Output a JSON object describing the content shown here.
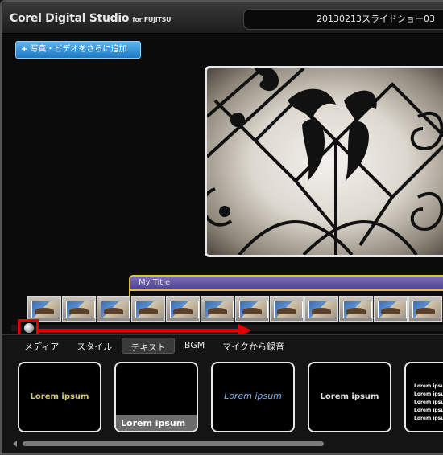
{
  "app": {
    "brand": "Corel Digital Studio",
    "brand_sub": "for FUJITSU",
    "project_name": "20130213スライドショー03"
  },
  "toolbar": {
    "add_media_label": "写真・ビデオをさらに追加",
    "add_icon": "plus-icon"
  },
  "timeline": {
    "title_track_label": "My Title",
    "frame_count": 12
  },
  "tabs": [
    {
      "label": "メディア",
      "active": false
    },
    {
      "label": "スタイル",
      "active": false
    },
    {
      "label": "テキスト",
      "active": true
    },
    {
      "label": "BGM",
      "active": false
    },
    {
      "label": "マイクから録音",
      "active": false
    }
  ],
  "text_templates": [
    {
      "label": "Lorem ipsum"
    },
    {
      "label": "Lorem ipsum"
    },
    {
      "label": "Lorem ipsum"
    },
    {
      "label": "Lorem ipsum"
    },
    {
      "lines": [
        "Lorem ipsum",
        "Lorem ipsum",
        "Lorem ipsum",
        "Lorem ipsum",
        "Lorem ipsum"
      ]
    }
  ],
  "colors": {
    "accent_blue": "#1c78c4",
    "title_track": "#5b52a0",
    "highlight_red": "#e00000"
  }
}
